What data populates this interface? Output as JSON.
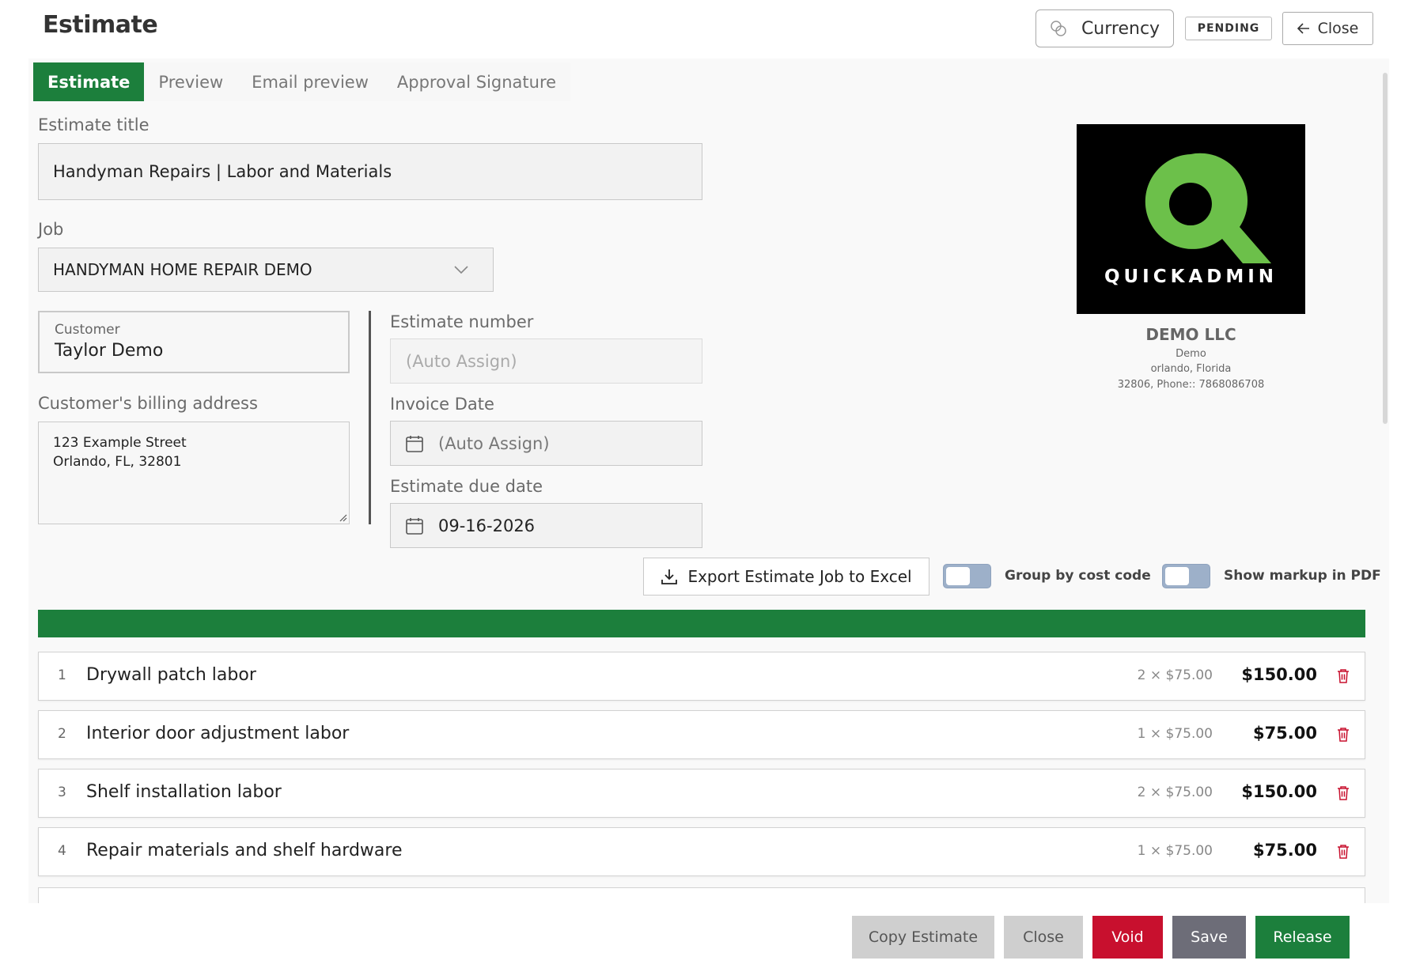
{
  "header": {
    "title": "Estimate",
    "currency_label": "Currency",
    "status": "PENDING",
    "close_label": "Close"
  },
  "tabs": [
    {
      "label": "Estimate",
      "active": true
    },
    {
      "label": "Preview",
      "active": false
    },
    {
      "label": "Email preview",
      "active": false
    },
    {
      "label": "Approval Signature",
      "active": false
    }
  ],
  "form": {
    "title_label": "Estimate title",
    "title_value": "Handyman Repairs | Labor and Materials",
    "job_label": "Job",
    "job_value": "HANDYMAN HOME REPAIR DEMO",
    "customer_label": "Customer",
    "customer_value": "Taylor Demo",
    "billing_label": "Customer's billing address",
    "billing_line1": "123 Example Street",
    "billing_line2": "Orlando, FL, 32801",
    "estimate_number_label": "Estimate number",
    "estimate_number_placeholder": "(Auto Assign)",
    "invoice_date_label": "Invoice Date",
    "invoice_date_placeholder": "(Auto Assign)",
    "due_date_label": "Estimate due date",
    "due_date_value": "09-16-2026"
  },
  "company": {
    "logo_text": "QUICKADMIN",
    "name": "DEMO LLC",
    "line1": "Demo",
    "line2": "orlando, Florida",
    "line3": "32806, Phone:: 7868086708"
  },
  "toolbar": {
    "export_label": "Export Estimate Job to Excel",
    "group_toggle_label": "Group by cost code",
    "markup_toggle_label": "Show markup in PDF"
  },
  "line_items": [
    {
      "num": "1",
      "description": "Drywall patch labor",
      "qty": "2 × $75.00",
      "total": "$150.00"
    },
    {
      "num": "2",
      "description": "Interior door adjustment labor",
      "qty": "1 × $75.00",
      "total": "$75.00"
    },
    {
      "num": "3",
      "description": "Shelf installation labor",
      "qty": "2 × $75.00",
      "total": "$150.00"
    },
    {
      "num": "4",
      "description": "Repair materials and shelf hardware",
      "qty": "1 × $75.00",
      "total": "$75.00"
    }
  ],
  "footer": {
    "copy_label": "Copy Estimate",
    "close_label": "Close",
    "void_label": "Void",
    "save_label": "Save",
    "release_label": "Release"
  },
  "colors": {
    "primary_green": "#1c7f3c",
    "void_red": "#c8102e",
    "save_gray": "#6d6d78",
    "logo_green": "#6cc04a"
  }
}
